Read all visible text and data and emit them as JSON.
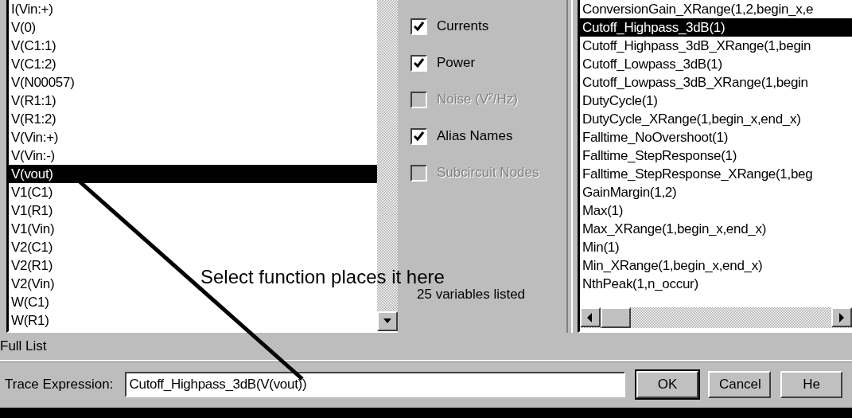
{
  "variables": {
    "items": [
      {
        "label": "I(Vin:+)",
        "selected": false
      },
      {
        "label": "V(0)",
        "selected": false
      },
      {
        "label": "V(C1:1)",
        "selected": false
      },
      {
        "label": "V(C1:2)",
        "selected": false
      },
      {
        "label": "V(N00057)",
        "selected": false
      },
      {
        "label": "V(R1:1)",
        "selected": false
      },
      {
        "label": "V(R1:2)",
        "selected": false
      },
      {
        "label": "V(Vin:+)",
        "selected": false
      },
      {
        "label": "V(Vin:-)",
        "selected": false
      },
      {
        "label": "V(vout)",
        "selected": true
      },
      {
        "label": "V1(C1)",
        "selected": false
      },
      {
        "label": "V1(R1)",
        "selected": false
      },
      {
        "label": "V1(Vin)",
        "selected": false
      },
      {
        "label": "V2(C1)",
        "selected": false
      },
      {
        "label": "V2(R1)",
        "selected": false
      },
      {
        "label": "V2(Vin)",
        "selected": false
      },
      {
        "label": "W(C1)",
        "selected": false
      },
      {
        "label": "W(R1)",
        "selected": false
      }
    ],
    "filter_label": "Full List",
    "count": "25 variables listed"
  },
  "options": [
    {
      "label": "Currents",
      "checked": true,
      "disabled": false
    },
    {
      "label": "Power",
      "checked": true,
      "disabled": false
    },
    {
      "label": "Noise (V²/Hz)",
      "checked": false,
      "disabled": true
    },
    {
      "label": "Alias Names",
      "checked": true,
      "disabled": false
    },
    {
      "label": "Subcircuit Nodes",
      "checked": false,
      "disabled": true
    }
  ],
  "functions": {
    "items": [
      {
        "label": "ConversionGain_XRange(1,2,begin_x,e",
        "selected": false
      },
      {
        "label": "Cutoff_Highpass_3dB(1)",
        "selected": true
      },
      {
        "label": "Cutoff_Highpass_3dB_XRange(1,begin",
        "selected": false
      },
      {
        "label": "Cutoff_Lowpass_3dB(1)",
        "selected": false
      },
      {
        "label": "Cutoff_Lowpass_3dB_XRange(1,begin",
        "selected": false
      },
      {
        "label": "DutyCycle(1)",
        "selected": false
      },
      {
        "label": "DutyCycle_XRange(1,begin_x,end_x)",
        "selected": false
      },
      {
        "label": "Falltime_NoOvershoot(1)",
        "selected": false
      },
      {
        "label": "Falltime_StepResponse(1)",
        "selected": false
      },
      {
        "label": "Falltime_StepResponse_XRange(1,beg",
        "selected": false
      },
      {
        "label": "GainMargin(1,2)",
        "selected": false
      },
      {
        "label": "Max(1)",
        "selected": false
      },
      {
        "label": "Max_XRange(1,begin_x,end_x)",
        "selected": false
      },
      {
        "label": "Min(1)",
        "selected": false
      },
      {
        "label": "Min_XRange(1,begin_x,end_x)",
        "selected": false
      },
      {
        "label": "NthPeak(1,n_occur)",
        "selected": false
      }
    ]
  },
  "annotation": {
    "text": "Select function places it here"
  },
  "trace_expression": {
    "label": "Trace Expression:",
    "value": "Cutoff_Highpass_3dB(V(vout))"
  },
  "buttons": [
    {
      "label": "OK",
      "default": true
    },
    {
      "label": "Cancel",
      "default": false
    },
    {
      "label": "He",
      "default": false
    }
  ]
}
